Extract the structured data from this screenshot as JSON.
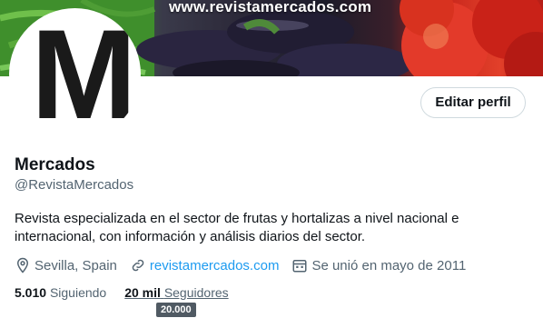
{
  "banner": {
    "url_text": "www.revistamercados.com"
  },
  "avatar": {
    "letter": "M"
  },
  "profile": {
    "edit_label": "Editar perfil",
    "name": "Mercados",
    "handle": "@RevistaMercados",
    "bio": "Revista especializada en el sector de frutas y hortalizas a nivel nacional e internacional, con información y análisis diarios del sector.",
    "location": "Sevilla, Spain",
    "website": "revistamercados.com",
    "joined": "Se unió en mayo de 2011"
  },
  "stats": {
    "following_count": "5.010",
    "following_label": "Siguiendo",
    "followers_count": "20 mil",
    "followers_label": "Seguidores",
    "tooltip": "20.000"
  },
  "colors": {
    "accent": "#1d9bf0",
    "secondary_text": "#536471"
  },
  "icons": {
    "location": "location-pin-icon",
    "link": "link-icon",
    "calendar": "calendar-icon"
  }
}
